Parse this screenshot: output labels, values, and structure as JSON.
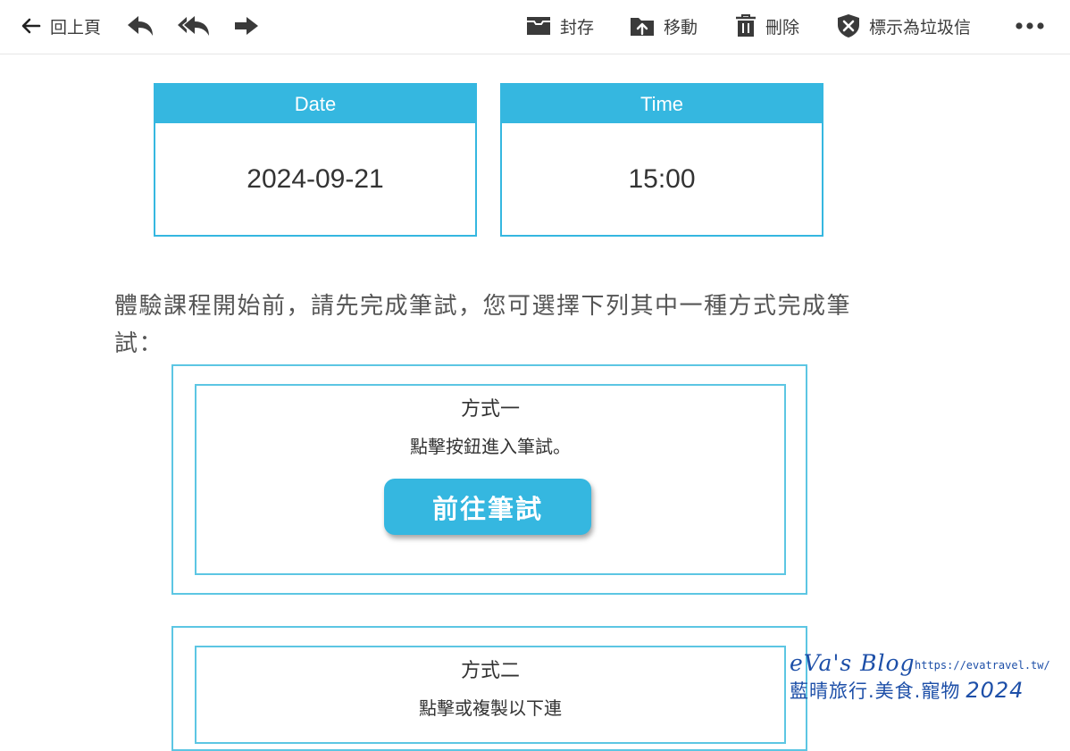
{
  "toolbar": {
    "back_label": "回上頁",
    "archive_label": "封存",
    "move_label": "移動",
    "delete_label": "刪除",
    "spam_label": "標示為垃圾信"
  },
  "schedule": {
    "date_header": "Date",
    "date_value": "2024-09-21",
    "time_header": "Time",
    "time_value": "15:00"
  },
  "intro_text": "體驗課程開始前，請先完成筆試，您可選擇下列其中一種方式完成筆試：",
  "method1": {
    "title": "方式一",
    "desc": "點擊按鈕進入筆試。",
    "button_label": "前往筆試"
  },
  "method2": {
    "title": "方式二",
    "desc": "點擊或複製以下連"
  },
  "watermark": {
    "blog": "eVa's Blog",
    "url": "https://evatravel.tw/",
    "subtitle": "藍晴旅行.美食.寵物",
    "year": "2024"
  },
  "colors": {
    "accent": "#35b7e0",
    "box_border": "#5cc6e3",
    "watermark": "#1d4fa8"
  }
}
